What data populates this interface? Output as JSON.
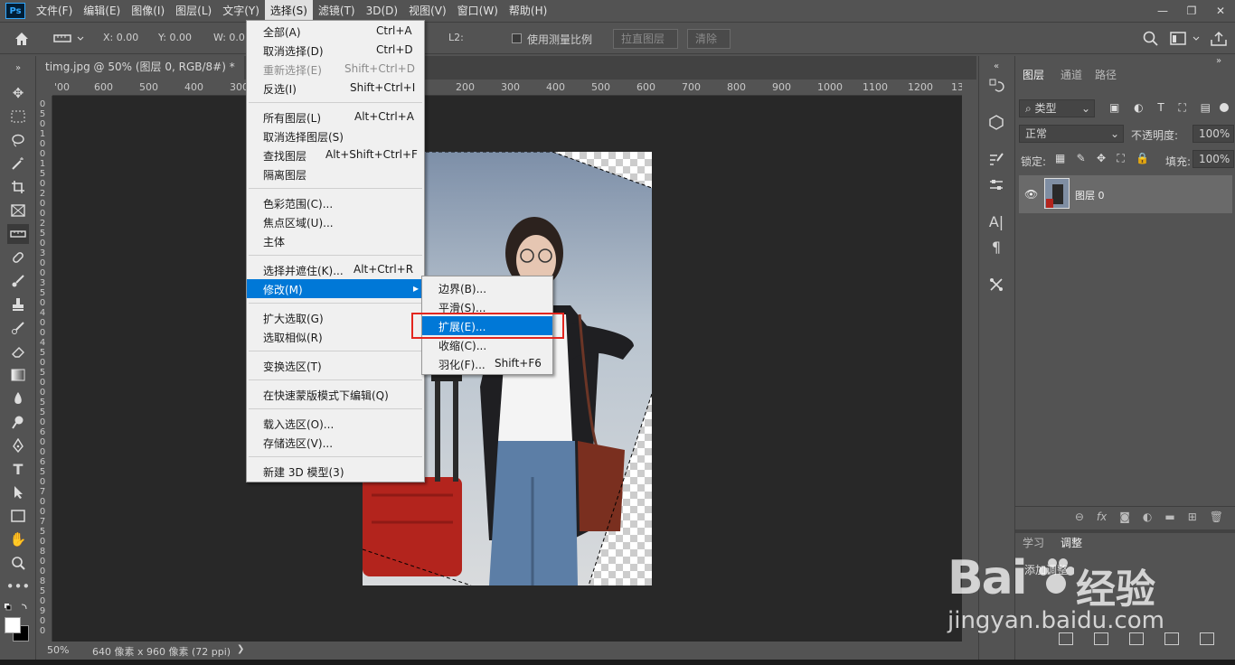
{
  "app": {
    "logo": "Ps"
  },
  "menubar": [
    "文件(F)",
    "编辑(E)",
    "图像(I)",
    "图层(L)",
    "文字(Y)",
    "选择(S)",
    "滤镜(T)",
    "3D(D)",
    "视图(V)",
    "窗口(W)",
    "帮助(H)"
  ],
  "window_controls": {
    "minimize": "—",
    "restore": "❐",
    "close": "✕"
  },
  "options": {
    "x": "X: 0.00",
    "y": "Y: 0.00",
    "w": "W: 0.0",
    "l2": "L2:",
    "use_scale": "使用测量比例",
    "straighten": "拉直图层",
    "clear": "清除"
  },
  "document": {
    "tab": "timg.jpg @ 50% (图层 0, RGB/8#) *"
  },
  "ruler_ticks": [
    "'00",
    "600",
    "500",
    "400",
    "300",
    "200",
    "300",
    "400",
    "500",
    "600",
    "700",
    "800",
    "900",
    "1000",
    "1100",
    "1200",
    "13"
  ],
  "ruler_left_labels": [
    "0",
    "5",
    "0",
    "1",
    "0",
    "0",
    "1",
    "5",
    "0",
    "2",
    "0",
    "0",
    "2",
    "5",
    "0",
    "3",
    "0",
    "0",
    "3",
    "5",
    "0",
    "4",
    "0",
    "0",
    "4",
    "5",
    "0",
    "5",
    "0",
    "0",
    "5",
    "5",
    "0",
    "6",
    "0",
    "0",
    "6",
    "5",
    "0",
    "7",
    "0",
    "0",
    "7",
    "5",
    "0",
    "8",
    "0",
    "0",
    "8",
    "5",
    "0",
    "9",
    "0",
    "0"
  ],
  "status": {
    "zoom": "50%",
    "doc_info": "640 像素 x 960 像素 (72 ppi)",
    "arrow": "❯"
  },
  "select_menu": {
    "items": [
      {
        "label": "全部(A)",
        "shortcut": "Ctrl+A"
      },
      {
        "label": "取消选择(D)",
        "shortcut": "Ctrl+D"
      },
      {
        "label": "重新选择(E)",
        "shortcut": "Shift+Ctrl+D"
      },
      {
        "label": "反选(I)",
        "shortcut": "Shift+Ctrl+I"
      },
      {
        "label": "所有图层(L)",
        "shortcut": "Alt+Ctrl+A"
      },
      {
        "label": "取消选择图层(S)",
        "shortcut": ""
      },
      {
        "label": "查找图层",
        "shortcut": "Alt+Shift+Ctrl+F"
      },
      {
        "label": "隔离图层",
        "shortcut": ""
      },
      {
        "label": "色彩范围(C)...",
        "shortcut": ""
      },
      {
        "label": "焦点区域(U)...",
        "shortcut": ""
      },
      {
        "label": "主体",
        "shortcut": ""
      },
      {
        "label": "选择并遮住(K)...",
        "shortcut": "Alt+Ctrl+R"
      },
      {
        "label": "修改(M)",
        "shortcut": ""
      },
      {
        "label": "扩大选取(G)",
        "shortcut": ""
      },
      {
        "label": "选取相似(R)",
        "shortcut": ""
      },
      {
        "label": "变换选区(T)",
        "shortcut": ""
      },
      {
        "label": "在快速蒙版模式下编辑(Q)",
        "shortcut": ""
      },
      {
        "label": "载入选区(O)...",
        "shortcut": ""
      },
      {
        "label": "存储选区(V)...",
        "shortcut": ""
      },
      {
        "label": "新建 3D 模型(3)",
        "shortcut": ""
      }
    ]
  },
  "modify_menu": {
    "items": [
      {
        "label": "边界(B)...",
        "shortcut": ""
      },
      {
        "label": "平滑(S)...",
        "shortcut": ""
      },
      {
        "label": "扩展(E)...",
        "shortcut": ""
      },
      {
        "label": "收缩(C)...",
        "shortcut": ""
      },
      {
        "label": "羽化(F)...",
        "shortcut": "Shift+F6"
      }
    ]
  },
  "layers_panel": {
    "tabs": [
      "图层",
      "通道",
      "路径"
    ],
    "filter": "类型",
    "blend_mode": "正常",
    "opacity_label": "不透明度:",
    "opacity": "100%",
    "lock_label": "锁定:",
    "fill_label": "填充:",
    "fill": "100%",
    "layer_name": "图层 0",
    "bottom_tabs": [
      "学习",
      "调整"
    ],
    "add_adjustment": "添加调整"
  },
  "watermark": {
    "brand": "Bai",
    "brand2": "经验",
    "url": "jingyan.baidu.com"
  },
  "colors": {
    "highlight": "#0078d7",
    "red_box": "#e3261f",
    "ps_blue": "#31a8ff"
  }
}
